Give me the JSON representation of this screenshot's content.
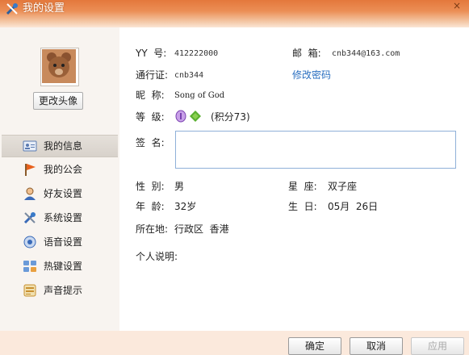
{
  "window": {
    "title": "我的设置",
    "close_glyph": "×"
  },
  "sidebar": {
    "change_avatar_label": "更改头像",
    "items": [
      {
        "label": "我的信息",
        "icon": "id-card-icon"
      },
      {
        "label": "我的公会",
        "icon": "flag-icon"
      },
      {
        "label": "好友设置",
        "icon": "friend-icon"
      },
      {
        "label": "系统设置",
        "icon": "tools-icon"
      },
      {
        "label": "语音设置",
        "icon": "voice-icon"
      },
      {
        "label": "热键设置",
        "icon": "hotkey-icon"
      },
      {
        "label": "声音提示",
        "icon": "sound-icon"
      }
    ]
  },
  "profile": {
    "yy_label": "YY  号:",
    "yy_value": "412222000",
    "email_label": "邮  箱:",
    "email_value": "cnb344@163.com",
    "passport_label": "通行证:",
    "passport_value": "cnb344",
    "change_password_label": "修改密码",
    "nickname_label": "昵  称:",
    "nickname_value": "Song of God",
    "level_label": "等  级:",
    "level_points": "(积分73)",
    "signature_label": "签  名:",
    "signature_value": "",
    "gender_label": "性  别:",
    "gender_value": "男",
    "zodiac_label": "星  座:",
    "zodiac_value": "双子座",
    "age_label": "年  龄:",
    "age_value": "32岁",
    "birthday_label": "生  日:",
    "birthday_value": "05月  26日",
    "location_label": "所在地:",
    "location_value": "行政区  香港",
    "intro_label": "个人说明:"
  },
  "footer": {
    "ok_label": "确定",
    "cancel_label": "取消",
    "apply_label": "应用"
  }
}
